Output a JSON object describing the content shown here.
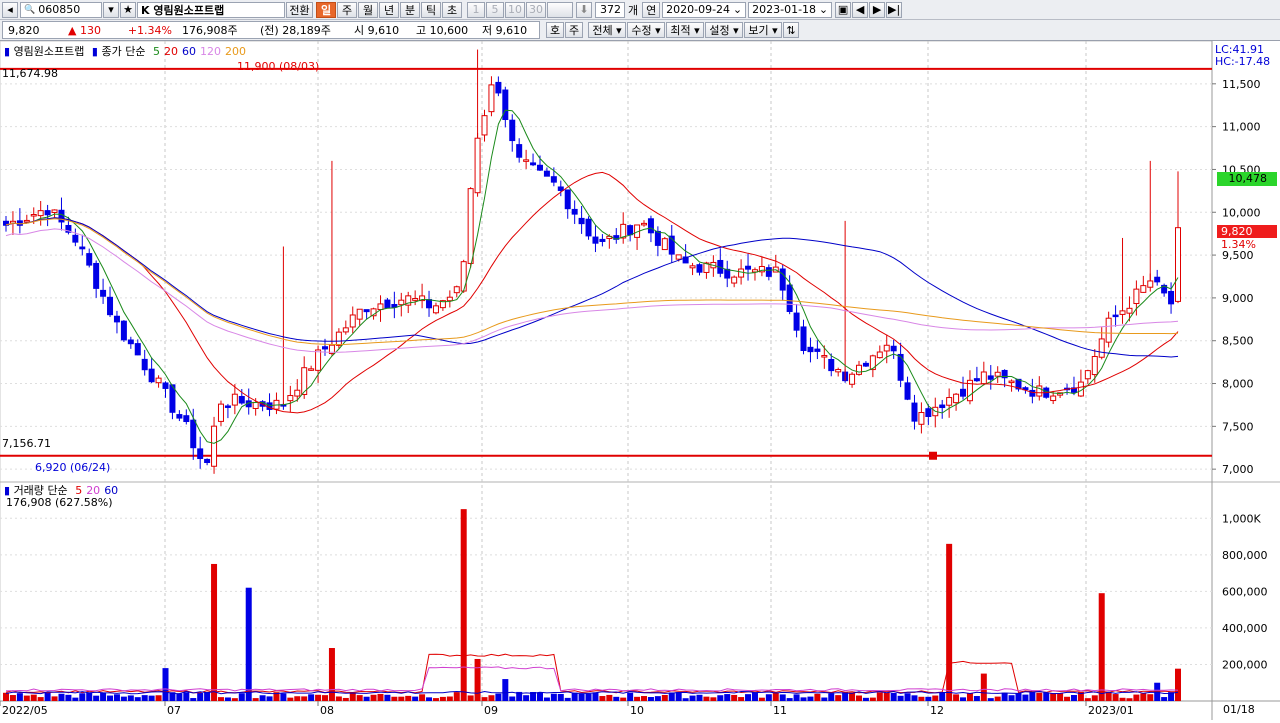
{
  "toolbar": {
    "code": "060850",
    "stock_name": "K 영림원소프트랩",
    "btn_switch": "전환",
    "periods": [
      "일",
      "주",
      "월",
      "년",
      "분",
      "틱",
      "초"
    ],
    "active_period": "일",
    "min_btns": [
      "1",
      "5",
      "10",
      "30"
    ],
    "count": "372",
    "count_unit": "개",
    "mode": "연",
    "date_from": "2020-09-24",
    "date_to": "2023-01-18"
  },
  "quote": {
    "price": "9,820",
    "change": "130",
    "change_pct": "+1.34%",
    "volume": "176,908주",
    "prev_volume": "(전) 28,189주",
    "open": "시 9,610",
    "high": "고 10,600",
    "low": "저 9,610",
    "ask_btn": "호",
    "stock_btn": "주",
    "menu": [
      "전체",
      "수정",
      "최적",
      "설정",
      "보기"
    ]
  },
  "price_pane": {
    "legend_name": "영림원소프트랩",
    "legend_type": "종가 단순",
    "ma": [
      {
        "label": "5",
        "color": "#1a8a1a"
      },
      {
        "label": "20",
        "color": "#e00000"
      },
      {
        "label": "60",
        "color": "#0000c8"
      },
      {
        "label": "120",
        "color": "#d887e6"
      },
      {
        "label": "200",
        "color": "#e89a1c"
      }
    ],
    "lc": "LC:41.91",
    "hc": "HC:-17.48",
    "high_line_label": "11,674.98",
    "low_line_label": "7,156.71",
    "max_label": "11,900 (08/03)",
    "min_label": "6,920 (06/24)",
    "ticks": [
      "11,500",
      "11,000",
      "10,500",
      "10,000",
      "9,500",
      "9,000",
      "8,500",
      "8,000",
      "7,500",
      "7,000"
    ],
    "green_tag": "10,478",
    "red_tag": "9,820",
    "red_tag_pct": "1.34%"
  },
  "volume_pane": {
    "legend_name": "거래량",
    "legend_type": "단순",
    "ma": [
      {
        "label": "5",
        "color": "#e00000"
      },
      {
        "label": "20",
        "color": "#d040d0"
      },
      {
        "label": "60",
        "color": "#0000c8"
      }
    ],
    "current": "176,908 (627.58%)",
    "ticks": [
      "1,000K",
      "800,000",
      "600,000",
      "400,000",
      "200,000"
    ]
  },
  "x_axis": [
    "2022/05",
    "07",
    "08",
    "09",
    "10",
    "11",
    "12",
    "2023/01"
  ],
  "x_axis_end": "01/18",
  "colors": {
    "up": "#e00000",
    "down": "#0000e6",
    "accent": "#e8672a",
    "green_tag": "#2bd52b"
  }
}
